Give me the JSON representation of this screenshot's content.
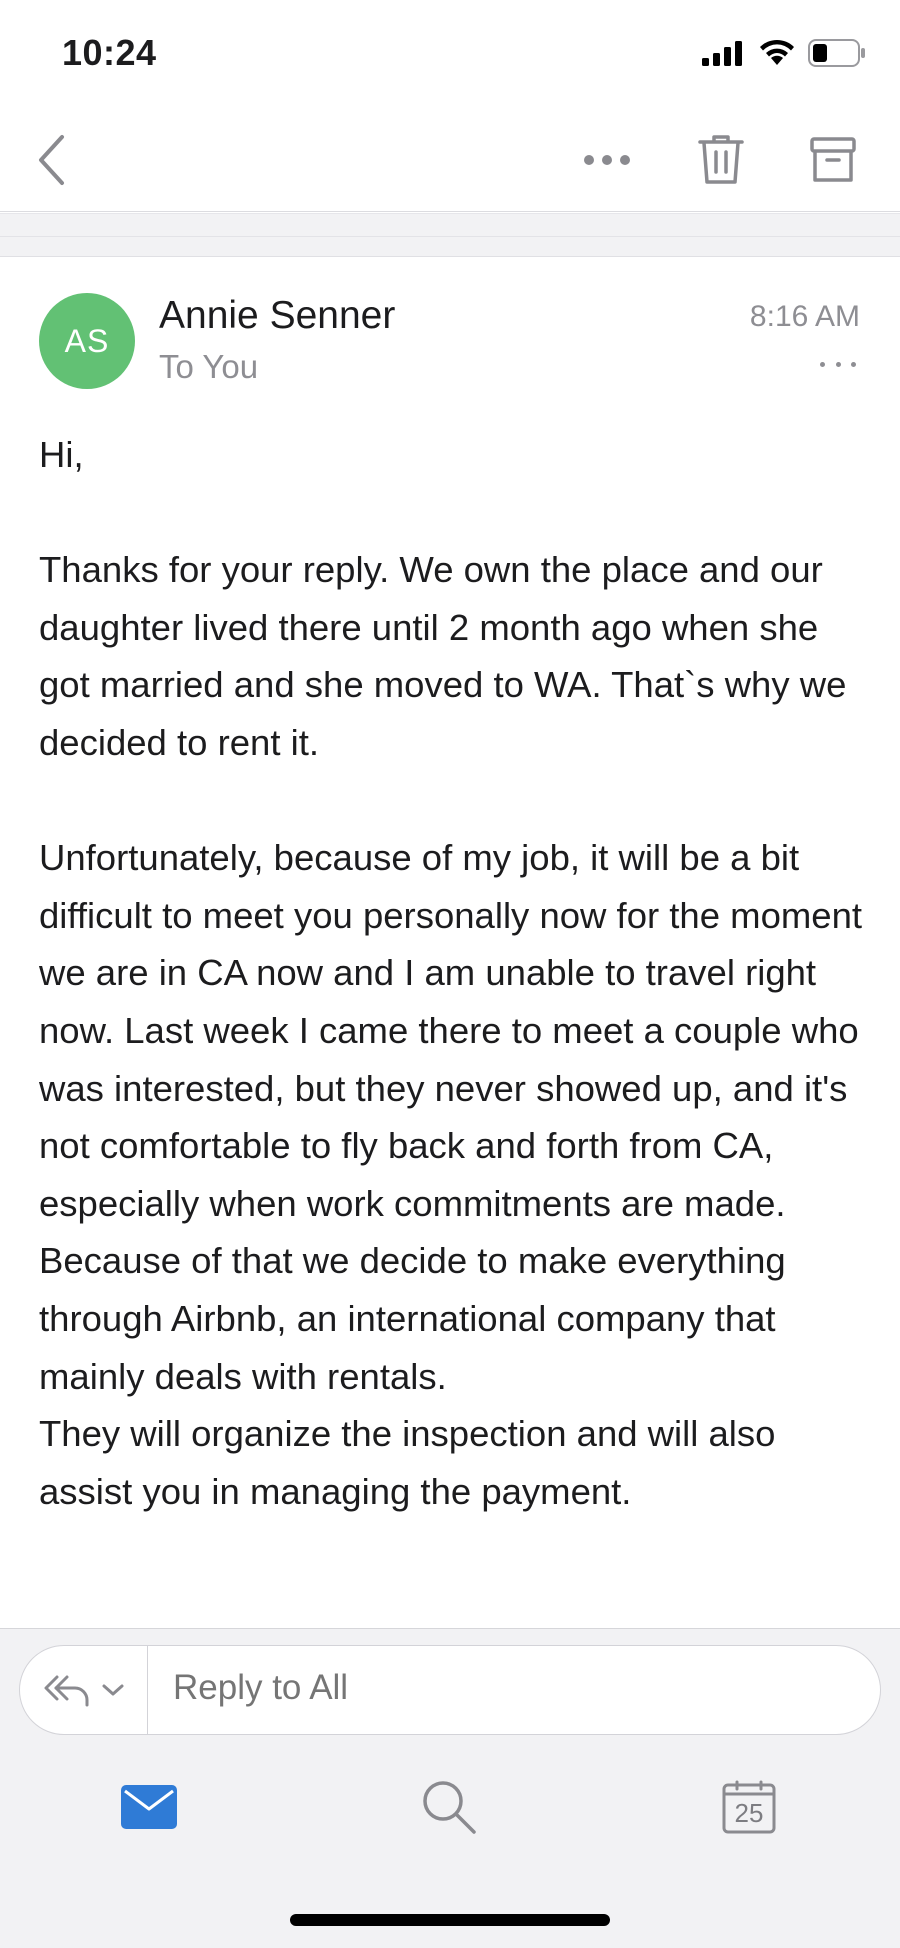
{
  "status_bar": {
    "time": "10:24",
    "signal_icon": "cellular-signal-icon",
    "wifi_icon": "wifi-icon",
    "battery_icon": "battery-icon"
  },
  "toolbar": {
    "back_icon": "chevron-left-icon",
    "more_icon": "more-horizontal-icon",
    "delete_icon": "trash-icon",
    "archive_icon": "archive-icon"
  },
  "message": {
    "avatar_initials": "AS",
    "avatar_color": "#62c174",
    "sender": "Annie Senner",
    "recipient": "To You",
    "time": "8:16 AM",
    "greeting": "Hi,",
    "paragraph_1": "Thanks for your reply. We own the place and our daughter lived there until 2 month ago when she got married and she moved to WA. That`s why we decided to rent it.",
    "paragraph_2": "Unfortunately, because of my job, it will be a bit difficult to meet you personally now for the moment we are in CA now and I am unable to travel right now. Last week I came there to meet a couple who was interested, but they never showed up, and it's not comfortable to fly back and forth from CA, especially when work commitments are made. Because of that we decide to make everything through Airbnb, an international company that mainly deals with rentals.",
    "paragraph_3": "They will organize the inspection and will also assist you in managing the payment."
  },
  "reply": {
    "placeholder": "Reply to All",
    "reply_all_icon": "reply-all-icon",
    "dropdown_icon": "chevron-down-icon"
  },
  "tabbar": {
    "mail_icon": "mail-icon",
    "search_icon": "search-icon",
    "calendar_icon": "calendar-icon",
    "calendar_day": "25",
    "accent_color": "#2f7bd6"
  }
}
